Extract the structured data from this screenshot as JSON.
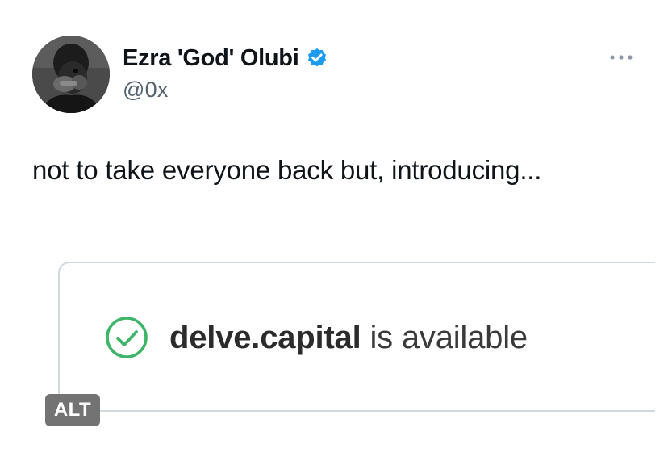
{
  "author": {
    "display_name": "Ezra 'God' Olubi",
    "handle": "@0x",
    "verified": true,
    "avatar_icon": "profile-photo",
    "verified_icon": "verified-badge-icon",
    "verified_color": "#1d9bf0"
  },
  "menu": {
    "more_icon": "more-horizontal-icon"
  },
  "tweet": {
    "text": "not to take everyone back but, introducing..."
  },
  "media": {
    "check_icon": "check-circle-icon",
    "check_color": "#3fb56a",
    "domain": "delve.capital",
    "status": " is available",
    "alt_label": "ALT"
  }
}
